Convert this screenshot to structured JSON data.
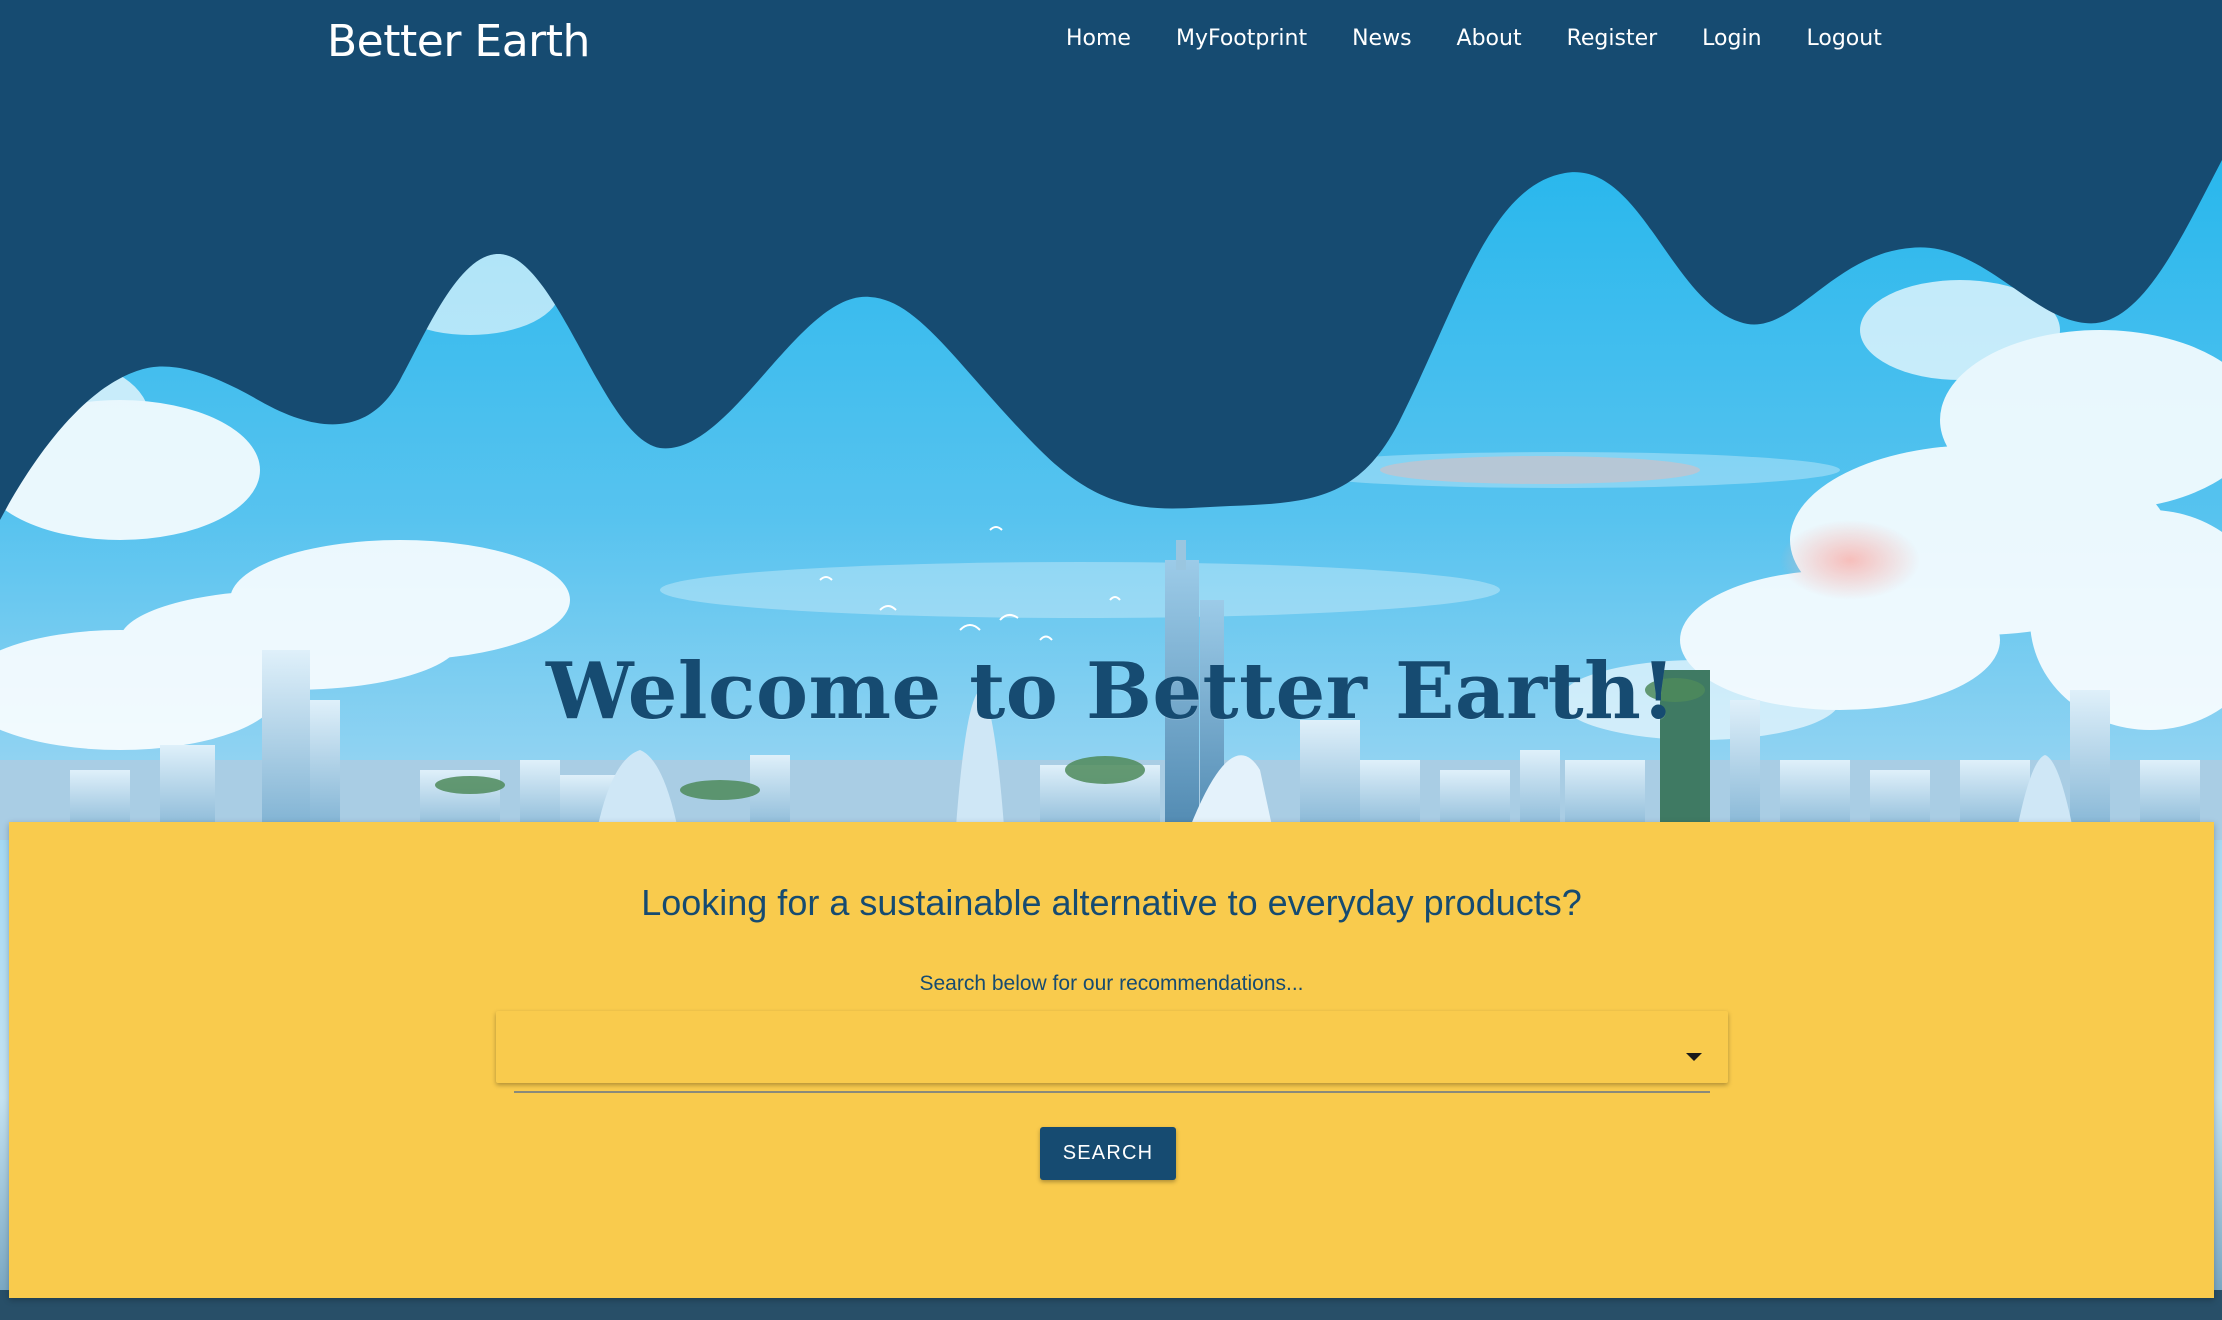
{
  "navbar": {
    "brand": "Better Earth",
    "links": [
      "Home",
      "MyFootprint",
      "News",
      "About",
      "Register",
      "Login",
      "Logout"
    ]
  },
  "hero": {
    "welcome": "Welcome to Better Earth!"
  },
  "search": {
    "heading": "Looking for a sustainable alternative to everyday products?",
    "subtext": "Search below for our recommendations...",
    "selected_value": "",
    "button_label": "SEARCH"
  },
  "colors": {
    "navy": "#164b71",
    "yellow": "#f9cb4d",
    "sky": "#2ab7ea",
    "white": "#ffffff"
  }
}
